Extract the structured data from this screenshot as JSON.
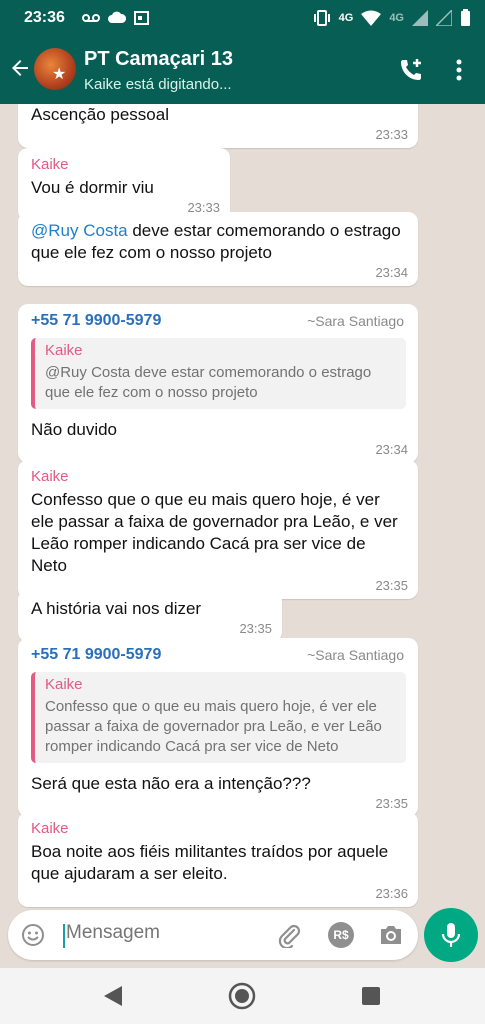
{
  "status_bar": {
    "time": "23:36",
    "network_4g_label": "4G",
    "network_lte_label": "4G"
  },
  "header": {
    "title": "PT Camaçari 13",
    "subtitle": "Kaike está digitando..."
  },
  "messages": [
    {
      "text": "Ascenção pessoal",
      "time": "23:33"
    },
    {
      "sender": "Kaike",
      "text": "Vou é dormir viu",
      "time": "23:33"
    },
    {
      "mention": "@Ruy Costa",
      "text": " deve estar comemorando o estrago que ele fez com o nosso projeto",
      "time": "23:34"
    },
    {
      "phone": "+55 71 9900-5979",
      "alias": "~Sara Santiago",
      "quote_sender": "Kaike",
      "quote_text": "@Ruy Costa deve estar comemorando o estrago que ele fez com o nosso projeto",
      "text": "Não duvido",
      "time": "23:34"
    },
    {
      "sender": "Kaike",
      "text": "Confesso que o que eu mais quero hoje, é ver ele passar a faixa de governador pra Leão, e ver Leão romper indicando Cacá pra ser vice de Neto",
      "time": "23:35"
    },
    {
      "text": "A história vai nos dizer",
      "time": "23:35"
    },
    {
      "phone": "+55 71 9900-5979",
      "alias": "~Sara Santiago",
      "quote_sender": "Kaike",
      "quote_text": "Confesso que o que eu mais quero hoje, é ver ele passar a faixa de governador pra Leão, e ver Leão romper indicando Cacá pra ser vice de Neto",
      "text": "Será que esta não era a intenção???",
      "time": "23:35"
    },
    {
      "sender": "Kaike",
      "text": "Boa noite aos fiéis militantes traídos por aquele que ajudaram a ser eleito.",
      "time": "23:36"
    }
  ],
  "composer": {
    "placeholder": "Mensagem",
    "pay_label": "R$"
  },
  "colors": {
    "header": "#075e54",
    "chat_background": "#e5ddd5",
    "sender_name": "#e35b85",
    "mention": "#1f7fc8",
    "mic_button": "#00a884"
  }
}
